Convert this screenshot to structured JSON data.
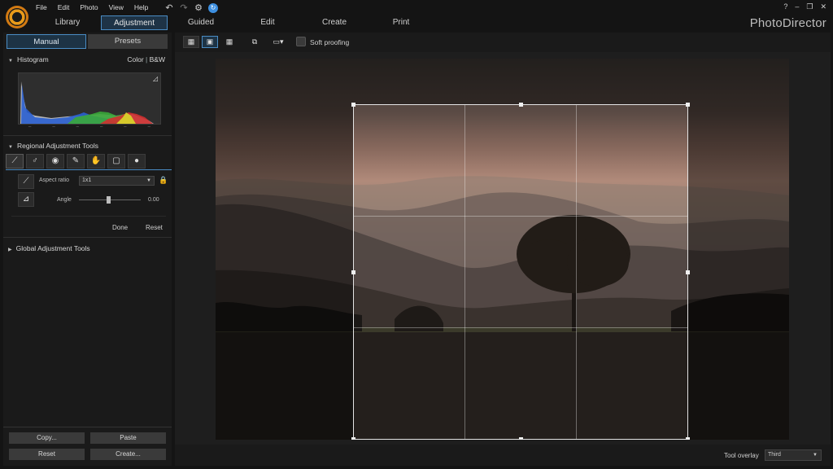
{
  "menu": [
    "File",
    "Edit",
    "Photo",
    "View",
    "Help"
  ],
  "quick_icons": [
    "undo-icon",
    "redo-icon",
    "settings-icon",
    "upgrade-icon"
  ],
  "mode_tabs": [
    {
      "label": "Library"
    },
    {
      "label": "Adjustment",
      "active": true
    },
    {
      "label": "Guided"
    },
    {
      "label": "Edit"
    },
    {
      "label": "Create"
    },
    {
      "label": "Print"
    }
  ],
  "brand": "PhotoDirector",
  "window_buttons": [
    "?",
    "–",
    "❐",
    "✕"
  ],
  "panel": {
    "tabs": [
      {
        "label": "Manual",
        "active": true
      },
      {
        "label": "Presets"
      }
    ],
    "histogram": {
      "title": "Histogram",
      "color": "Color",
      "sep": "|",
      "bw": "B&W",
      "axis_marks": [
        "–",
        "–",
        "–",
        "–",
        "–",
        "–"
      ]
    },
    "regional": {
      "title": "Regional Adjustment Tools",
      "aspect_label": "Aspect ratio",
      "aspect_value": "1x1",
      "angle_label": "Angle",
      "angle_value": "0.00",
      "angle_level": 0.5,
      "done": "Done",
      "reset": "Reset"
    },
    "global": {
      "title": "Global Adjustment Tools"
    },
    "bottom_buttons": [
      "Copy...",
      "Paste",
      "Reset",
      "Create..."
    ]
  },
  "toolbar": {
    "soft_proofing": "Soft proofing"
  },
  "bottom": {
    "tool_overlay_label": "Tool overlay",
    "tool_overlay_value": "Third"
  },
  "colors": {
    "accent": "#4a8cc4",
    "lock": "#e2b33a",
    "logo": "#e89a1a"
  }
}
